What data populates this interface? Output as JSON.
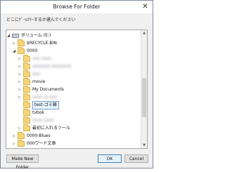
{
  "window": {
    "title": "Browse For Folder",
    "close_glyph": "✕"
  },
  "instruction": "どこにｹﾞｰﾑﾂﾘｰするか選んでください",
  "tree": {
    "rows": [
      {
        "label": "ボリューム (E:)",
        "icon": "drive-icon",
        "arrow": "◢"
      },
      {
        "label": "$RECYCLE.BIN",
        "icon": "folder-icon",
        "arrow": "▷"
      },
      {
        "label": "0000",
        "icon": "folder-icon",
        "arrow": "◢"
      },
      {
        "label": "xxx xxxx",
        "icon": "folder-icon",
        "arrow": "▷",
        "blurred": true
      },
      {
        "label": "xxxxxxx xxxxxxxx",
        "icon": "folder-icon",
        "arrow": "▷",
        "blurred": true
      },
      {
        "label": "xxx",
        "icon": "folder-icon",
        "arrow": "▷",
        "blurred": true
      },
      {
        "label": "movie",
        "icon": "folder-icon",
        "arrow": "▷"
      },
      {
        "label": "My Documents",
        "icon": "folder-icon",
        "arrow": "▷"
      },
      {
        "label": "xxxx xx xxx",
        "icon": "folder-icon",
        "arrow": "▷",
        "blurred": true
      },
      {
        "label": "test-ゴミ箱",
        "icon": "folder-icon",
        "arrow": "",
        "selected": true
      },
      {
        "label": "tvbok",
        "icon": "folder-icon",
        "arrow": ""
      },
      {
        "label": "xxxx xxxx",
        "icon": "folder-icon",
        "arrow": "",
        "blurred": true
      },
      {
        "label": "最初に入れるツール",
        "icon": "folder-icon",
        "arrow": "▷"
      },
      {
        "label": "0000-Blues",
        "icon": "folder-icon",
        "arrow": "▷"
      },
      {
        "label": "000ワード文章",
        "icon": "folder-icon",
        "arrow": "▷"
      }
    ]
  },
  "scrollbar": {
    "up": "▲",
    "down": "▼"
  },
  "buttons": {
    "new_folder": "Make New Folder",
    "ok": "OK",
    "cancel": "Cancel"
  }
}
